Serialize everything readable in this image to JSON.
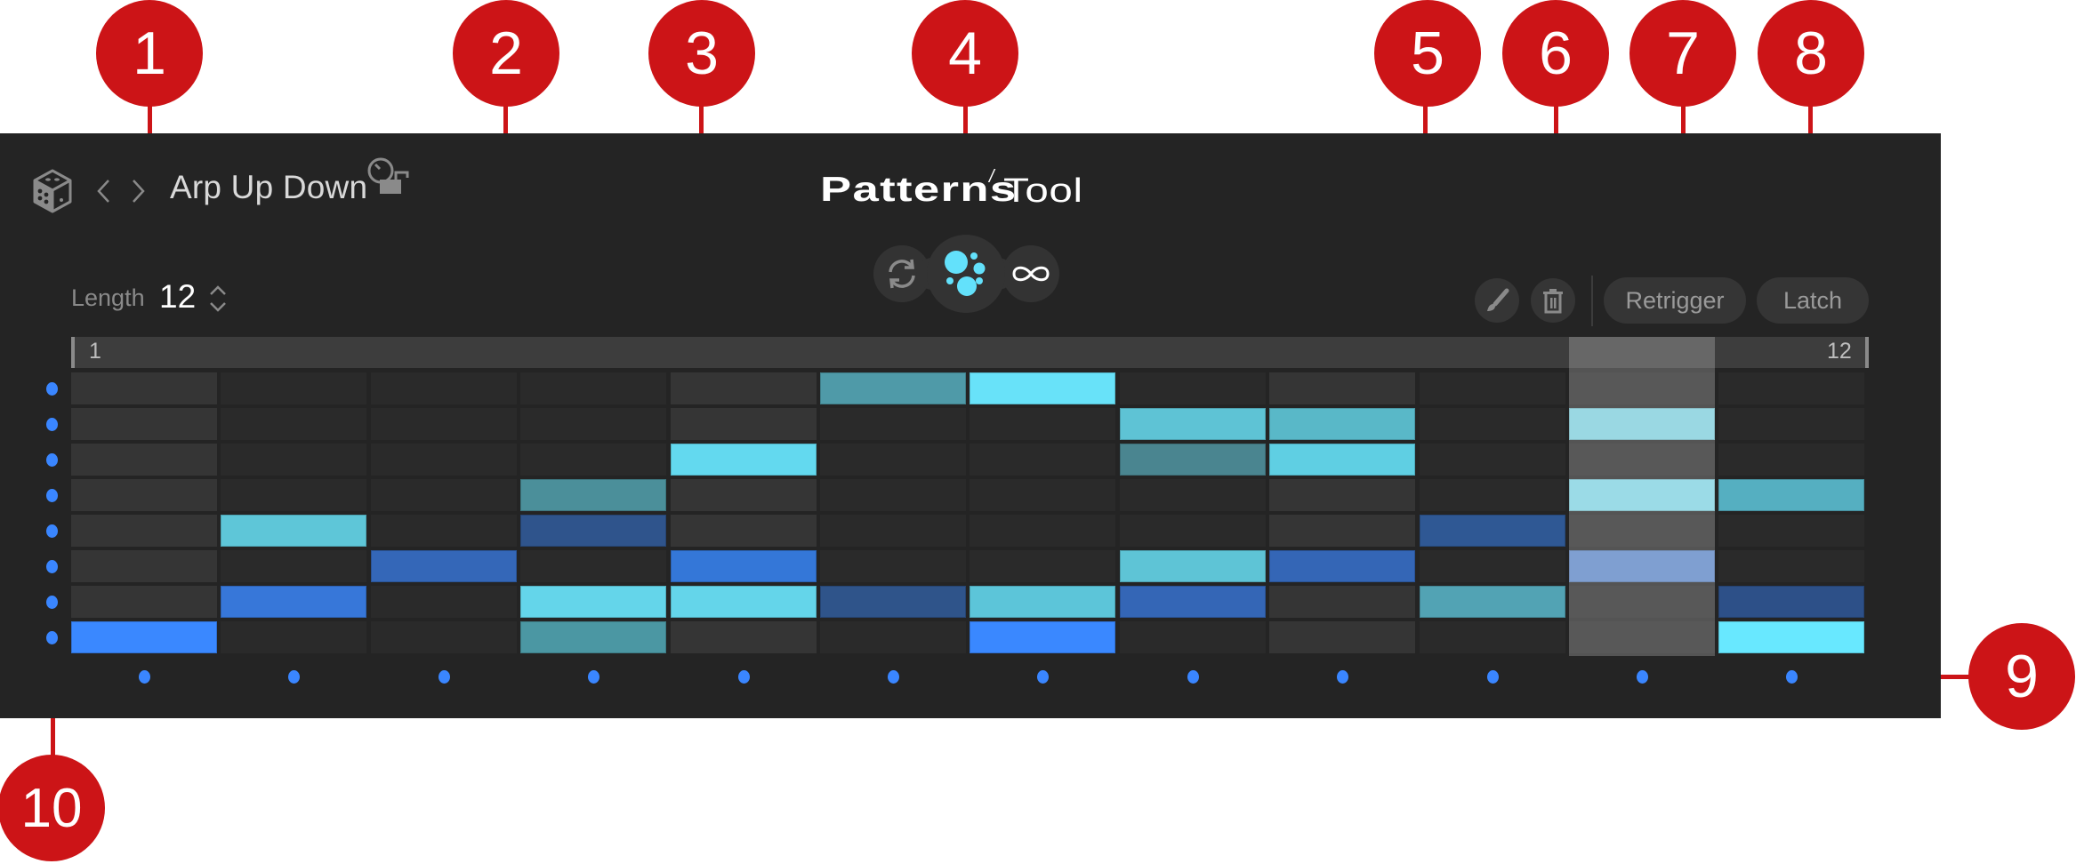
{
  "header": {
    "dice_icon": "dice-icon",
    "prev_icon": "chevron-left-icon",
    "next_icon": "chevron-right-icon",
    "prev_symbol": "‹",
    "next_symbol": "›",
    "preset_name": "Arp Up Down",
    "lock_icon": "knob-lock-icon",
    "logo_bold": "Patterns",
    "logo_slash": "/",
    "logo_light": "Tool"
  },
  "modes": {
    "items": [
      {
        "name": "cycle",
        "icon": "cycle-arrows-icon",
        "active": false
      },
      {
        "name": "random",
        "icon": "random-dots-icon",
        "active": true
      },
      {
        "name": "infinite",
        "icon": "infinity-icon",
        "active": false
      }
    ]
  },
  "length": {
    "label": "Length",
    "value": "12"
  },
  "tools": {
    "paint_icon": "paintbrush-icon",
    "delete_icon": "trash-icon",
    "retrigger_label": "Retrigger",
    "latch_label": "Latch"
  },
  "steps": {
    "start_label": "1",
    "end_label": "12",
    "count": 12,
    "playhead_step": 11
  },
  "grid": {
    "rows": 8,
    "columns": 12,
    "empty_color": "#2a2a2a",
    "beat_empty_color": "#353535",
    "beat_columns": [
      1,
      5,
      9
    ],
    "row_dot_color": "#3a86ff",
    "cells": [
      {
        "row": 1,
        "col": 6,
        "color": "#4f9aa8"
      },
      {
        "row": 1,
        "col": 7,
        "color": "#68e2f9"
      },
      {
        "row": 2,
        "col": 8,
        "color": "#5ec3d5"
      },
      {
        "row": 2,
        "col": 9,
        "color": "#59b8c8"
      },
      {
        "row": 2,
        "col": 11,
        "color": "#7ecddc"
      },
      {
        "row": 3,
        "col": 5,
        "color": "#63d9ef"
      },
      {
        "row": 3,
        "col": 8,
        "color": "#4a8590"
      },
      {
        "row": 3,
        "col": 9,
        "color": "#5fcfe3"
      },
      {
        "row": 4,
        "col": 4,
        "color": "#4b8f9a"
      },
      {
        "row": 4,
        "col": 11,
        "color": "#7fd1e0"
      },
      {
        "row": 4,
        "col": 12,
        "color": "#55afc1"
      },
      {
        "row": 5,
        "col": 2,
        "color": "#5ec6d8"
      },
      {
        "row": 5,
        "col": 4,
        "color": "#2f548c"
      },
      {
        "row": 5,
        "col": 10,
        "color": "#2f5894"
      },
      {
        "row": 6,
        "col": 3,
        "color": "#3467b8"
      },
      {
        "row": 6,
        "col": 5,
        "color": "#3477d8"
      },
      {
        "row": 6,
        "col": 8,
        "color": "#5ec4d6"
      },
      {
        "row": 6,
        "col": 9,
        "color": "#3466b6"
      },
      {
        "row": 6,
        "col": 11,
        "color": "#5c84c4"
      },
      {
        "row": 7,
        "col": 2,
        "color": "#3777d9"
      },
      {
        "row": 7,
        "col": 4,
        "color": "#64d5ea"
      },
      {
        "row": 7,
        "col": 5,
        "color": "#64d5ea"
      },
      {
        "row": 7,
        "col": 6,
        "color": "#2f548a"
      },
      {
        "row": 7,
        "col": 7,
        "color": "#5cc5d9"
      },
      {
        "row": 7,
        "col": 8,
        "color": "#3466b6"
      },
      {
        "row": 7,
        "col": 10,
        "color": "#52a3b4"
      },
      {
        "row": 7,
        "col": 12,
        "color": "#2d5088"
      },
      {
        "row": 8,
        "col": 1,
        "color": "#3a88ff"
      },
      {
        "row": 8,
        "col": 4,
        "color": "#4b97a3"
      },
      {
        "row": 8,
        "col": 7,
        "color": "#3a88ff"
      },
      {
        "row": 8,
        "col": 12,
        "color": "#68e8ff"
      }
    ]
  },
  "annotations": [
    {
      "label": "1"
    },
    {
      "label": "2"
    },
    {
      "label": "3"
    },
    {
      "label": "4"
    },
    {
      "label": "5"
    },
    {
      "label": "6"
    },
    {
      "label": "7"
    },
    {
      "label": "8"
    },
    {
      "label": "9"
    },
    {
      "label": "10"
    }
  ],
  "colors": {
    "panel_bg": "#242424",
    "accent_cyan": "#63e1fb",
    "accent_blue": "#3a86ff",
    "annotation_red": "#cc1417"
  }
}
